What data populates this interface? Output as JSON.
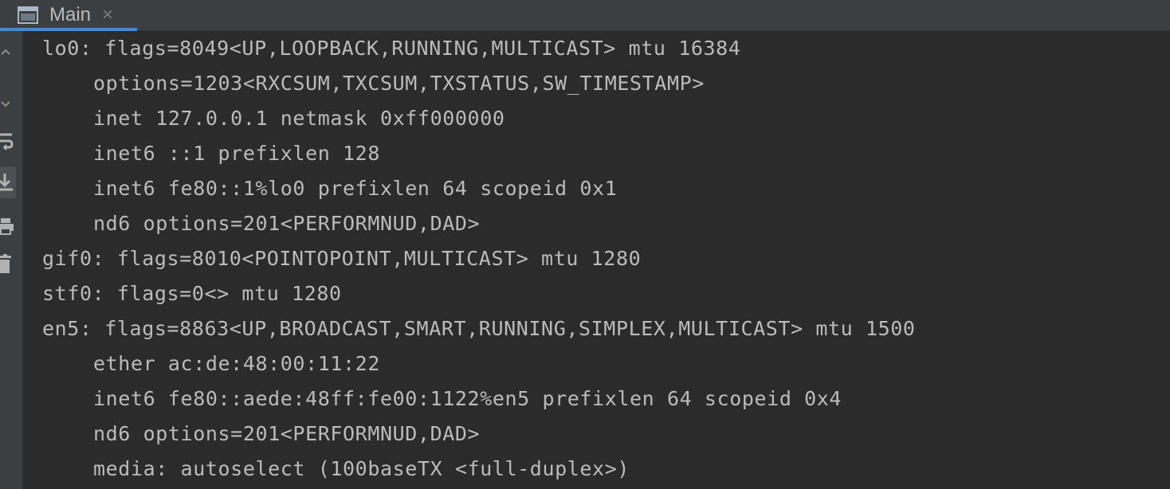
{
  "tab": {
    "icon": "console-window-icon",
    "label": "Main",
    "close_glyph": "×"
  },
  "gutter": {
    "icons": [
      "up-arrow-icon",
      "down-arrow-icon",
      "soft-wrap-icon",
      "scroll-to-end-icon",
      "print-icon",
      "trash-icon"
    ]
  },
  "console": {
    "lines": [
      {
        "indent": false,
        "text": "lo0: flags=8049<UP,LOOPBACK,RUNNING,MULTICAST> mtu 16384"
      },
      {
        "indent": true,
        "text": "options=1203<RXCSUM,TXCSUM,TXSTATUS,SW_TIMESTAMP>"
      },
      {
        "indent": true,
        "text": "inet 127.0.0.1 netmask 0xff000000"
      },
      {
        "indent": true,
        "text": "inet6 ::1 prefixlen 128"
      },
      {
        "indent": true,
        "text": "inet6 fe80::1%lo0 prefixlen 64 scopeid 0x1"
      },
      {
        "indent": true,
        "text": "nd6 options=201<PERFORMNUD,DAD>"
      },
      {
        "indent": false,
        "text": "gif0: flags=8010<POINTOPOINT,MULTICAST> mtu 1280"
      },
      {
        "indent": false,
        "text": "stf0: flags=0<> mtu 1280"
      },
      {
        "indent": false,
        "text": "en5: flags=8863<UP,BROADCAST,SMART,RUNNING,SIMPLEX,MULTICAST> mtu 1500"
      },
      {
        "indent": true,
        "text": "ether ac:de:48:00:11:22"
      },
      {
        "indent": true,
        "text": "inet6 fe80::aede:48ff:fe00:1122%en5 prefixlen 64 scopeid 0x4"
      },
      {
        "indent": true,
        "text": "nd6 options=201<PERFORMNUD,DAD>"
      },
      {
        "indent": true,
        "text": "media: autoselect (100baseTX <full-duplex>)"
      }
    ]
  },
  "colors": {
    "background": "#2b2b2b",
    "panel": "#3c3f41",
    "text": "#bbbbbb",
    "tab_accent": "#4a88c7"
  }
}
